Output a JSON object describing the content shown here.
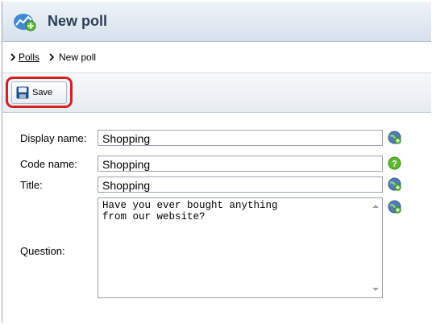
{
  "header": {
    "title": "New poll",
    "icon": "poll-chart-add-icon"
  },
  "breadcrumb": {
    "link": "Polls",
    "current": "New poll"
  },
  "toolbar": {
    "save_label": "Save"
  },
  "form": {
    "display_name": {
      "label": "Display name:",
      "value": "Shopping",
      "icon": "localize-globe-icon"
    },
    "code_name": {
      "label": "Code name:",
      "value": "Shopping",
      "icon": "help-icon"
    },
    "title": {
      "label": "Title:",
      "value": "Shopping",
      "icon": "localize-globe-icon"
    },
    "question": {
      "label": "Question:",
      "value": "Have you ever bought anything\nfrom our website?",
      "icon": "localize-globe-icon"
    }
  },
  "colors": {
    "highlight": "#d42020",
    "header_title": "#2b3e57",
    "help_green": "#5cb82e"
  }
}
